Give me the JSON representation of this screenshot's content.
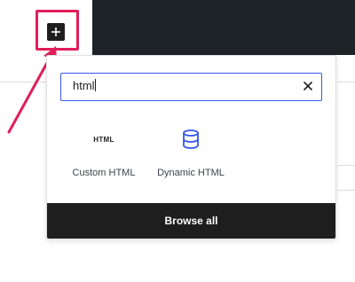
{
  "inserter": {
    "icon": "plus-icon"
  },
  "search": {
    "value": "html"
  },
  "blocks": [
    {
      "label": "Custom HTML",
      "icon_text": "HTML",
      "icon": "html-icon"
    },
    {
      "label": "Dynamic HTML",
      "icon": "database-icon"
    }
  ],
  "browse_all_label": "Browse all",
  "colors": {
    "highlight": "#e11d5a",
    "accent": "#3858e9",
    "dark": "#1e1e1e"
  }
}
